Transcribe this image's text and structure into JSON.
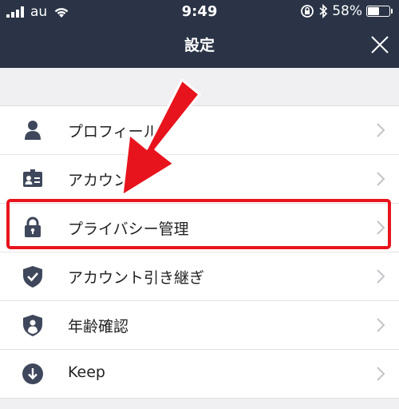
{
  "status_bar": {
    "carrier": "au",
    "time": "9:49",
    "battery_text": "58%",
    "battery_level": 0.58
  },
  "header": {
    "title": "設定",
    "close_icon": "close-icon"
  },
  "menu": {
    "items": [
      {
        "label": "プロフィール",
        "icon": "person-icon"
      },
      {
        "label": "アカウント",
        "icon": "id-card-icon"
      },
      {
        "label": "プライバシー管理",
        "icon": "lock-icon"
      },
      {
        "label": "アカウント引き継ぎ",
        "icon": "shield-check-icon"
      },
      {
        "label": "年齢確認",
        "icon": "shield-person-icon"
      },
      {
        "label": "Keep",
        "icon": "keep-download-icon"
      }
    ]
  },
  "colors": {
    "header_bg": "#2a3446",
    "icon": "#3f475c",
    "highlight": "#e8141d",
    "background": "#f0f0f3"
  }
}
